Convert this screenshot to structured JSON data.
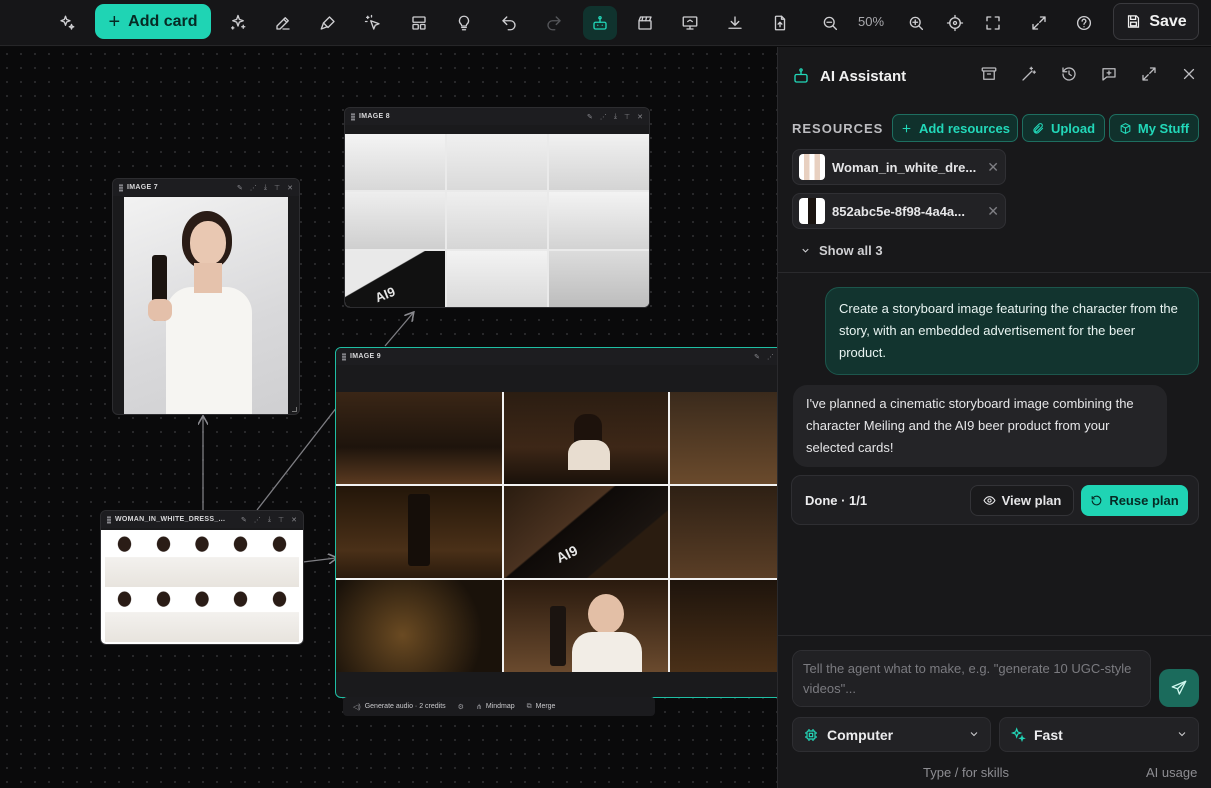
{
  "toolbar": {
    "add_card_label": "Add card",
    "zoom_level": "50%",
    "save_label": "Save"
  },
  "canvas": {
    "cards": {
      "image7": {
        "title": "IMAGE 7"
      },
      "image8": {
        "title": "IMAGE 8"
      },
      "image9": {
        "title": "IMAGE 9"
      },
      "woman": {
        "title": "WOMAN_IN_WHITE_DRESS_..."
      }
    },
    "image9_bottle_label": "AI9",
    "image8_bottle_label": "AI9",
    "storyboard_bar": {
      "generate_audio": "Generate audio · 2 credits",
      "mindmap": "Mindmap",
      "merge": "Merge"
    }
  },
  "panel": {
    "title": "AI Assistant",
    "resources_label": "RESOURCES",
    "add_resources_label": "Add resources",
    "upload_label": "Upload",
    "my_stuff_label": "My Stuff",
    "resources": [
      {
        "name": "Woman_in_white_dre..."
      },
      {
        "name": "852abc5e-8f98-4a4a..."
      }
    ],
    "show_all_label": "Show all 3",
    "user_message": "Create a storyboard image featuring the character from the story, with an embedded advertisement for the beer product.",
    "ai_message": "I've planned a cinematic storyboard image combining the character Meiling and the AI9 beer product from your selected cards!",
    "plan_status": "Done · 1/1",
    "view_plan_label": "View plan",
    "reuse_plan_label": "Reuse plan",
    "prompt_placeholder": "Tell the agent what to make, e.g. \"generate 10 UGC-style videos\"...",
    "mode_select": "Computer",
    "speed_select": "Fast",
    "skills_hint": "Type / for skills",
    "ai_usage_label": "AI usage"
  },
  "colors": {
    "accent": "#1fd4b4",
    "background": "#0b0b0c",
    "panel": "#18181a"
  }
}
